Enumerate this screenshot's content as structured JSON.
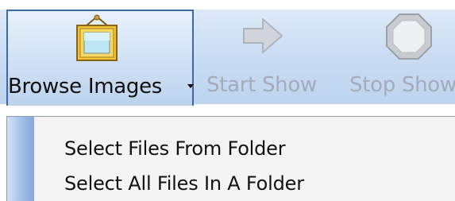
{
  "toolbar": {
    "browse_label": "Browse Images",
    "start_label": "Start Show",
    "stop_label": "Stop Show"
  },
  "menu": {
    "items": [
      {
        "label": "Select Files From Folder"
      },
      {
        "label": "Select All Files In A Folder"
      }
    ]
  },
  "icons": {
    "browse": "picture-frame-icon",
    "start": "arrow-right-icon",
    "stop": "stop-octagon-icon"
  },
  "colors": {
    "toolbar_bg": "#c9dcf3",
    "pressed_border": "#3b6aa8",
    "disabled_text": "#a3acb8",
    "menu_bg": "#f4f4f4"
  }
}
